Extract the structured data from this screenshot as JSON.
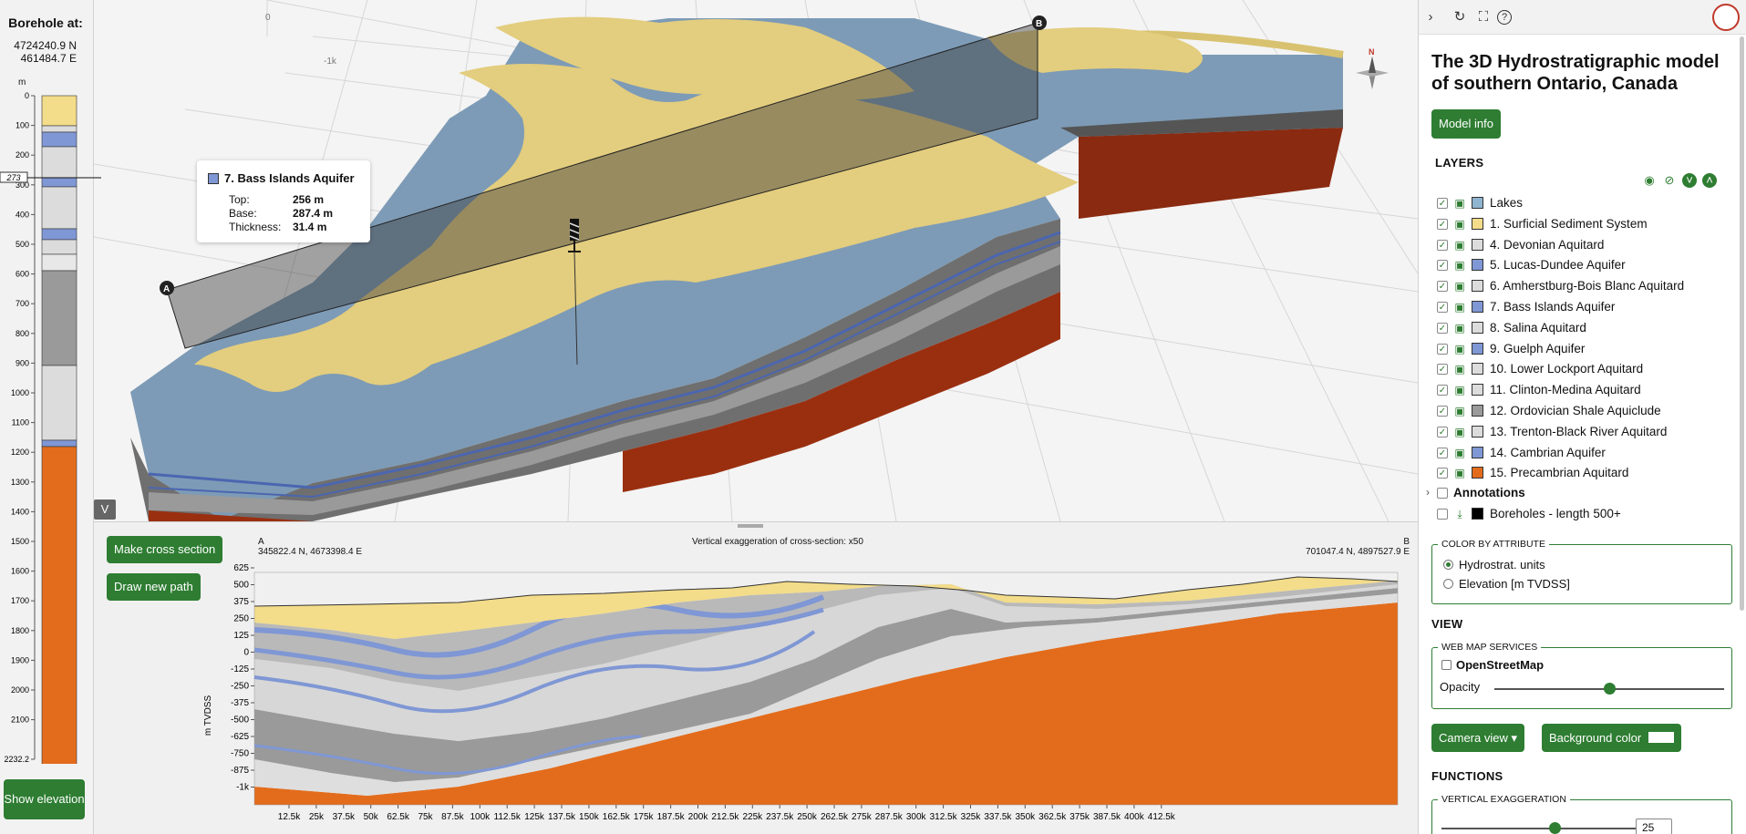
{
  "borehole": {
    "title": "Borehole at:",
    "northing": "4724240.9  N",
    "easting": "461484.7  E",
    "unit": "m",
    "depth_ticks": [
      "0",
      "100",
      "200",
      "300",
      "400",
      "500",
      "600",
      "700",
      "800",
      "900",
      "1000",
      "1100",
      "1200",
      "1300",
      "1400",
      "1500",
      "1600",
      "1700",
      "1800",
      "1900",
      "2000",
      "2100",
      "2232.2"
    ],
    "marker": "273",
    "show_elevation": "Show elevation"
  },
  "tooltip": {
    "title": "7. Bass Islands Aquifer",
    "top_label": "Top:",
    "top_value": "256 m",
    "base_label": "Base:",
    "base_value": "287.4 m",
    "thickness_label": "Thickness:",
    "thickness_value": "31.4 m"
  },
  "view3d": {
    "point_a": "A",
    "point_b": "B",
    "compass": "N",
    "axis_labels": [
      "-1k",
      "0"
    ],
    "collapse_icon": "V"
  },
  "cross_section": {
    "make_button": "Make cross section",
    "draw_button": "Draw new path",
    "label_a": "A",
    "label_b": "B",
    "coord_a": "345822.4 N, 4673398.4 E",
    "coord_b": "701047.4 N, 4897527.9 E",
    "exaggeration": "Vertical exaggeration of cross-section: x50",
    "y_axis_label": "m TVDSS",
    "y_ticks": [
      "625",
      "500",
      "375",
      "250",
      "125",
      "0",
      "-125",
      "-250",
      "-375",
      "-500",
      "-625",
      "-750",
      "-875",
      "-1k"
    ],
    "x_ticks": [
      "12.5k",
      "25k",
      "37.5k",
      "50k",
      "62.5k",
      "75k",
      "87.5k",
      "100k",
      "112.5k",
      "125k",
      "137.5k",
      "150k",
      "162.5k",
      "175k",
      "187.5k",
      "200k",
      "212.5k",
      "225k",
      "237.5k",
      "250k",
      "262.5k",
      "275k",
      "287.5k",
      "300k",
      "312.5k",
      "325k",
      "337.5k",
      "350k",
      "362.5k",
      "375k",
      "387.5k",
      "400k",
      "412.5k"
    ]
  },
  "toolbar": {
    "expand_icon": "chevron-right-icon",
    "reset_icon": "reset-icon",
    "fullscreen_icon": "fullscreen-icon",
    "help_icon": "help-icon"
  },
  "panel": {
    "title": "The 3D Hydrostratigraphic model of southern Ontario, Canada",
    "model_info": "Model info",
    "layers_heading": "LAYERS",
    "layers": [
      {
        "label": "Lakes",
        "color": "#8fb4cf"
      },
      {
        "label": "1. Surficial Sediment System",
        "color": "#f3dc8a"
      },
      {
        "label": "4. Devonian Aquitard",
        "color": "#dcdcdc"
      },
      {
        "label": "5. Lucas-Dundee Aquifer",
        "color": "#7f97d4"
      },
      {
        "label": "6. Amherstburg-Bois Blanc Aquitard",
        "color": "#dcdcdc"
      },
      {
        "label": "7. Bass Islands Aquifer",
        "color": "#7f97d4"
      },
      {
        "label": "8. Salina Aquitard",
        "color": "#dcdcdc"
      },
      {
        "label": "9. Guelph Aquifer",
        "color": "#7f97d4"
      },
      {
        "label": "10. Lower Lockport Aquitard",
        "color": "#dcdcdc"
      },
      {
        "label": "11. Clinton-Medina Aquitard",
        "color": "#dcdcdc"
      },
      {
        "label": "12. Ordovician Shale Aquiclude",
        "color": "#9a9a9a"
      },
      {
        "label": "13. Trenton-Black River Aquitard",
        "color": "#dcdcdc"
      },
      {
        "label": "14. Cambrian Aquifer",
        "color": "#7f97d4"
      },
      {
        "label": "15. Precambrian Aquitard",
        "color": "#e36c1c"
      }
    ],
    "annotations": "Annotations",
    "boreholes": "Boreholes - length 500+",
    "color_by": "COLOR BY ATTRIBUTE",
    "color_options": [
      "Hydrostrat. units",
      "Elevation [m TVDSS]"
    ],
    "view_heading": "VIEW",
    "wms": "WEB MAP SERVICES",
    "osm": "OpenStreetMap",
    "opacity": "Opacity",
    "opacity_value": 0.5,
    "camera_view": "Camera view ▾",
    "background_color": "Background color",
    "functions_heading": "FUNCTIONS",
    "vertical_exaggeration": "VERTICAL EXAGGERATION",
    "vexag_value": "25"
  }
}
